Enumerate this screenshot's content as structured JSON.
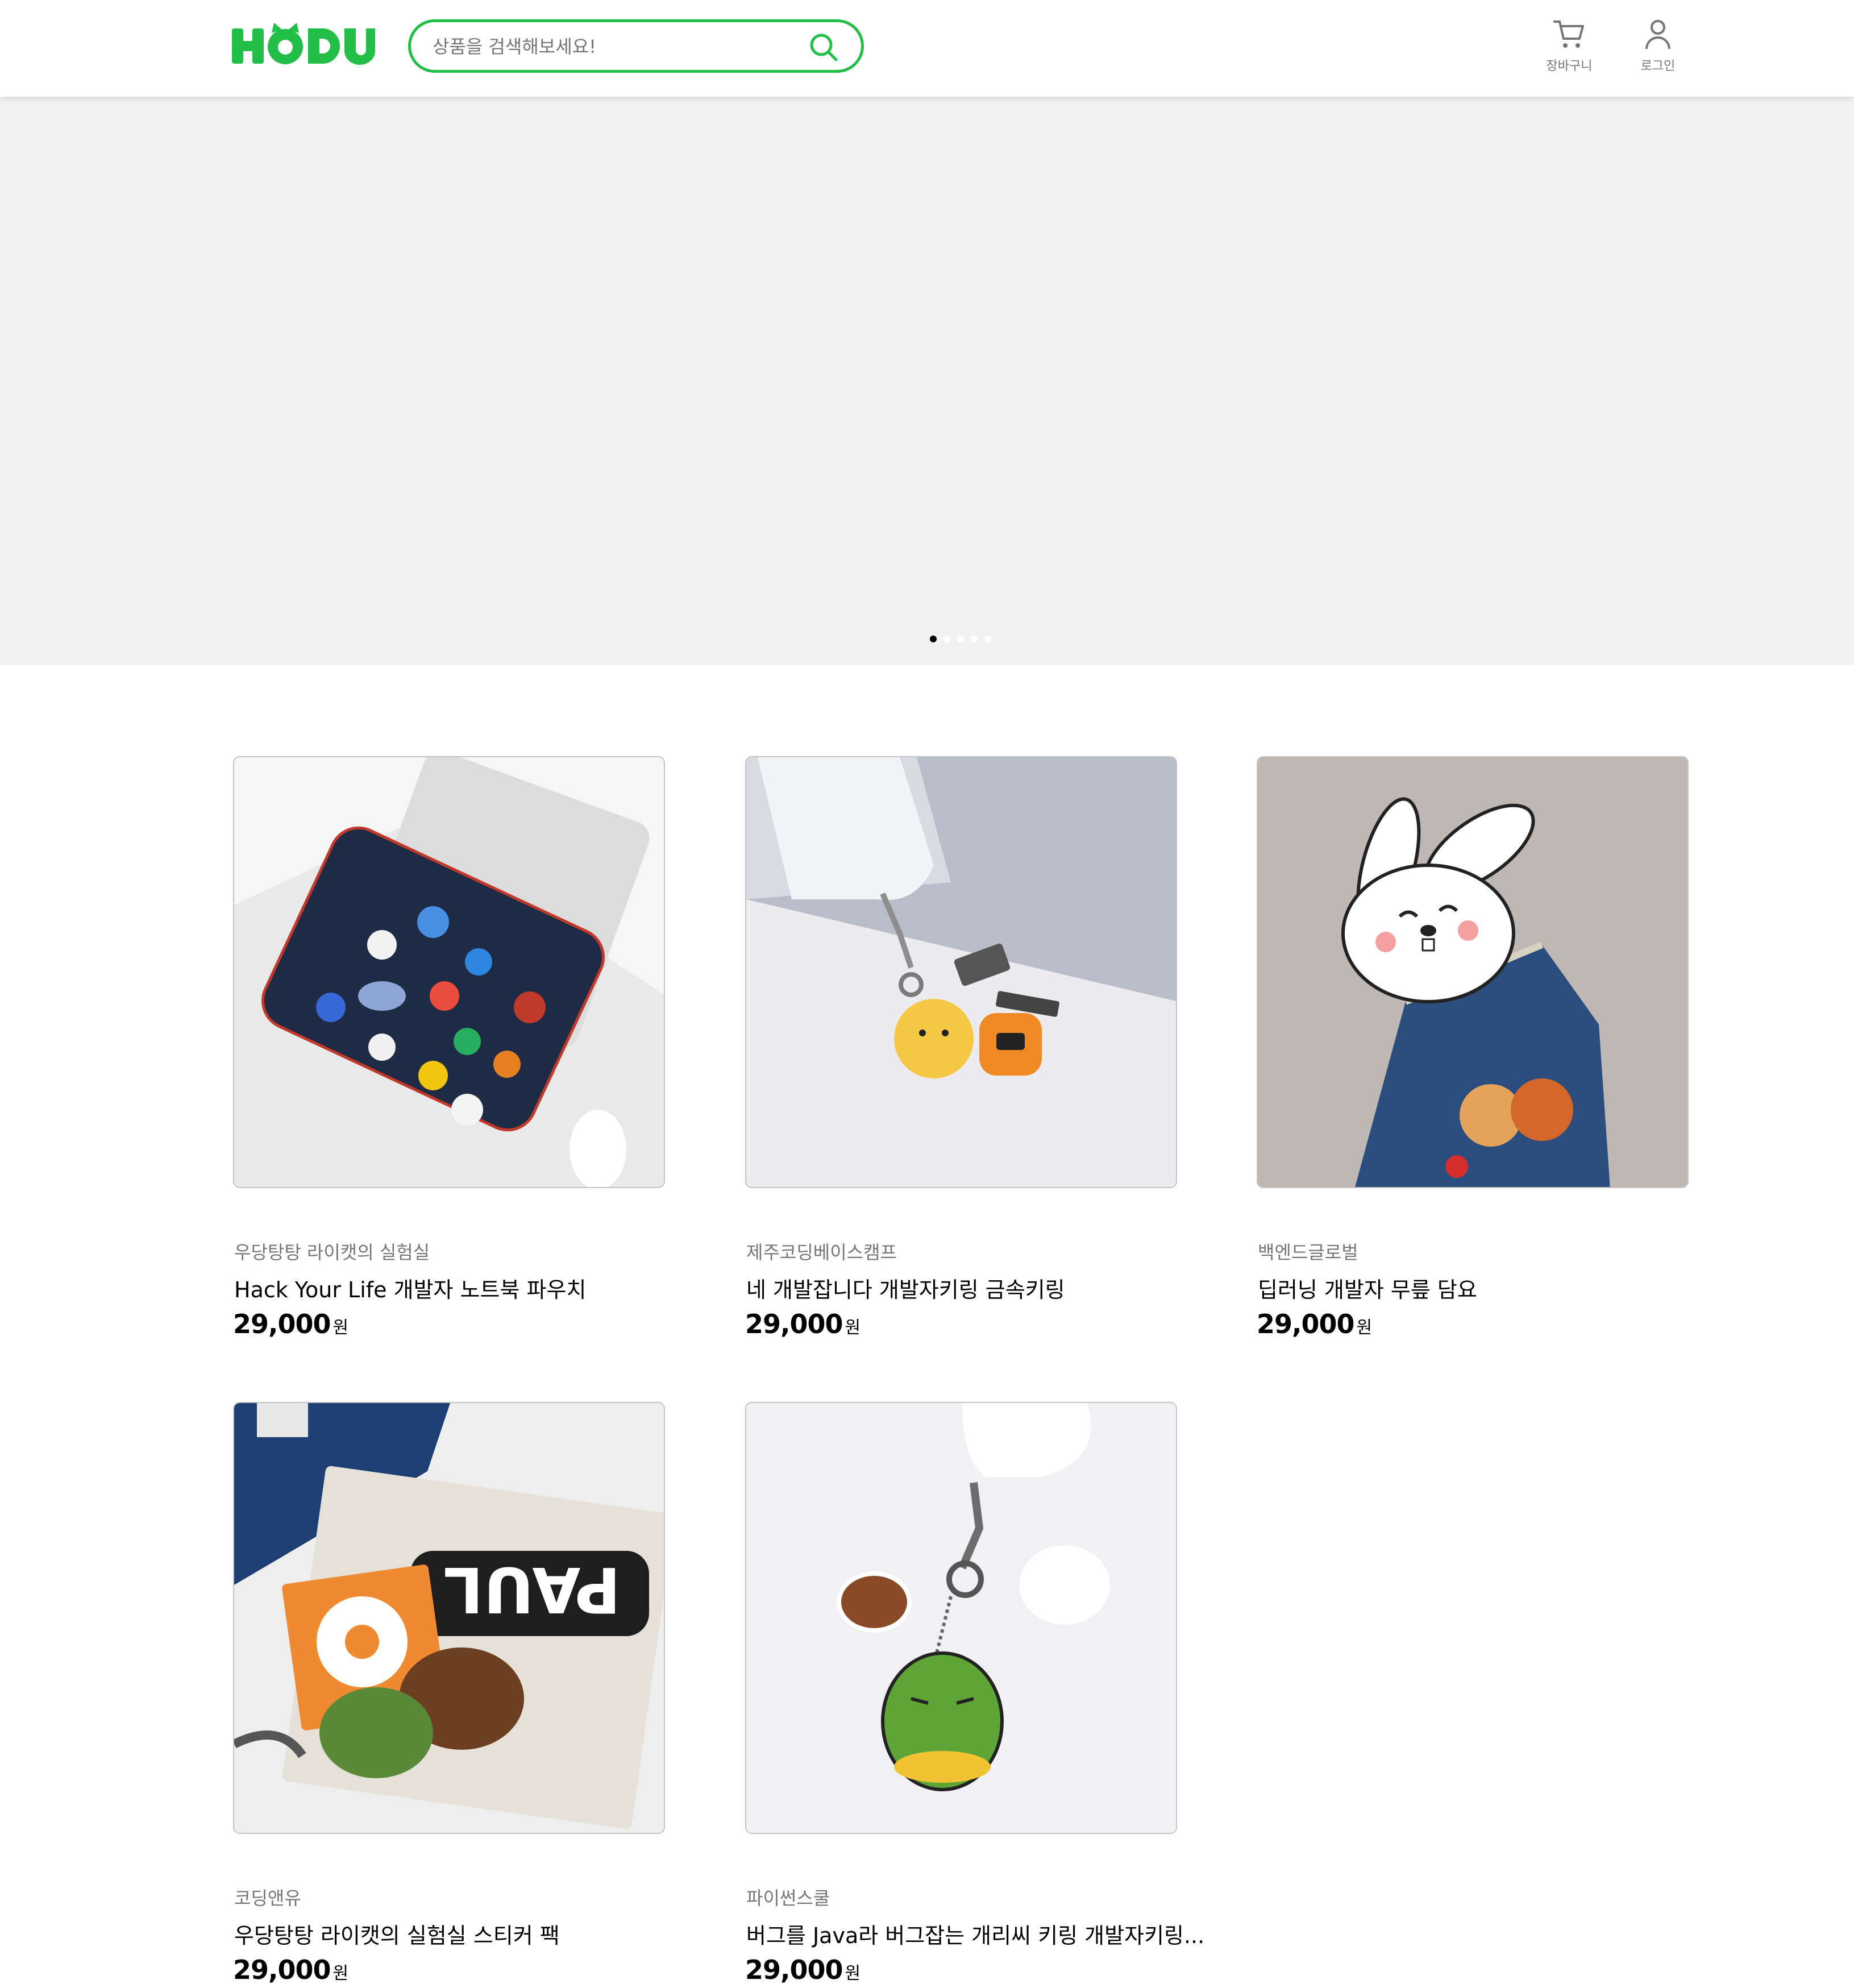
{
  "header": {
    "logo_text": "HODU",
    "search_placeholder": "상품을 검색해보세요!",
    "cart_label": "장바구니",
    "login_label": "로그인"
  },
  "banner": {
    "slide_count": 5,
    "active_slide": 1
  },
  "products": [
    {
      "seller": "우당탕탕 라이캣의 실험실",
      "name": "Hack Your Life 개발자 노트북 파우치",
      "price": "29,000",
      "unit": "원"
    },
    {
      "seller": "제주코딩베이스캠프",
      "name": "네 개발잡니다 개발자키링 금속키링",
      "price": "29,000",
      "unit": "원"
    },
    {
      "seller": "백엔드글로벌",
      "name": "딥러닝 개발자 무릎 담요",
      "price": "29,000",
      "unit": "원"
    },
    {
      "seller": "코딩앤유",
      "name": "우당탕탕 라이캣의 실험실 스티커 팩",
      "price": "29,000",
      "unit": "원"
    },
    {
      "seller": "파이썬스쿨",
      "name": "버그를 Java라 버그잡는 개리씨 키링 개발자키링...",
      "price": "29,000",
      "unit": "원"
    }
  ],
  "colors": {
    "brand": "#21BF48",
    "banner_bg": "#F2F2F2",
    "muted_text": "#767676"
  }
}
